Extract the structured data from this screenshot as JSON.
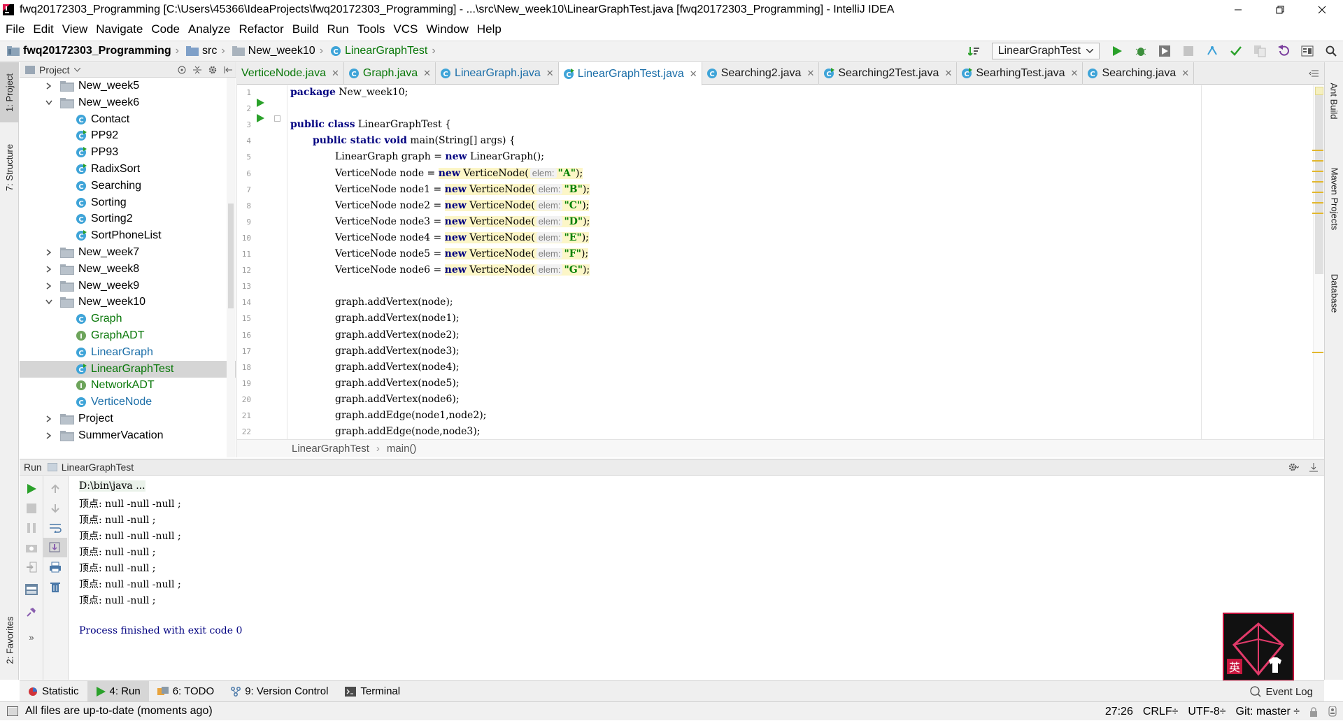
{
  "window": {
    "title": "fwq20172303_Programming [C:\\Users\\45366\\IdeaProjects\\fwq20172303_Programming] - ...\\src\\New_week10\\LinearGraphTest.java [fwq20172303_Programming] - IntelliJ IDEA"
  },
  "menu": [
    "File",
    "Edit",
    "View",
    "Navigate",
    "Code",
    "Analyze",
    "Refactor",
    "Build",
    "Run",
    "Tools",
    "VCS",
    "Window",
    "Help"
  ],
  "nav": {
    "project": "fwq20172303_Programming",
    "src": "src",
    "package": "New_week10",
    "file": "LinearGraphTest",
    "run_config": "LinearGraphTest"
  },
  "left_stripe": {
    "project": "1: Project",
    "structure": "7: Structure",
    "favorites": "2: Favorites"
  },
  "right_stripe": {
    "ant": "Ant Build",
    "maven": "Maven Projects",
    "database": "Database"
  },
  "project_panel": {
    "title": "Project",
    "rows": [
      {
        "label": "New_week5",
        "kind": "folder",
        "expanded": false
      },
      {
        "label": "New_week6",
        "kind": "folder",
        "expanded": true
      },
      {
        "label": "Contact",
        "kind": "class"
      },
      {
        "label": "PP92",
        "kind": "class-main"
      },
      {
        "label": "PP93",
        "kind": "class-main"
      },
      {
        "label": "RadixSort",
        "kind": "class-main"
      },
      {
        "label": "Searching",
        "kind": "class"
      },
      {
        "label": "Sorting",
        "kind": "class"
      },
      {
        "label": "Sorting2",
        "kind": "class"
      },
      {
        "label": "SortPhoneList",
        "kind": "class-main"
      },
      {
        "label": "New_week7",
        "kind": "folder",
        "expanded": false
      },
      {
        "label": "New_week8",
        "kind": "folder",
        "expanded": false
      },
      {
        "label": "New_week9",
        "kind": "folder",
        "expanded": false
      },
      {
        "label": "New_week10",
        "kind": "folder",
        "expanded": true
      },
      {
        "label": "Graph",
        "kind": "class",
        "vcs": "added"
      },
      {
        "label": "GraphADT",
        "kind": "interface",
        "vcs": "added"
      },
      {
        "label": "LinearGraph",
        "kind": "class",
        "vcs": "modified"
      },
      {
        "label": "LinearGraphTest",
        "kind": "class-main",
        "vcs": "added",
        "selected": true
      },
      {
        "label": "NetworkADT",
        "kind": "interface",
        "vcs": "added"
      },
      {
        "label": "VerticeNode",
        "kind": "class",
        "vcs": "modified"
      },
      {
        "label": "Project",
        "kind": "folder",
        "expanded": false
      },
      {
        "label": "SummerVacation",
        "kind": "folder",
        "expanded": false
      }
    ]
  },
  "tabs": [
    {
      "label": "VerticeNode.java",
      "vcs": "added",
      "icon": "none"
    },
    {
      "label": "Graph.java",
      "vcs": "added",
      "icon": "class"
    },
    {
      "label": "LinearGraph.java",
      "vcs": "modified",
      "icon": "class"
    },
    {
      "label": "LinearGraphTest.java",
      "vcs": "modified",
      "icon": "class-main",
      "active": true
    },
    {
      "label": "Searching2.java",
      "vcs": "normal",
      "icon": "class"
    },
    {
      "label": "Searching2Test.java",
      "vcs": "normal",
      "icon": "class-main"
    },
    {
      "label": "SearhingTest.java",
      "vcs": "normal",
      "icon": "class-main"
    },
    {
      "label": "Searching.java",
      "vcs": "normal",
      "icon": "class"
    }
  ],
  "editor": {
    "line_numbers": [
      "1",
      "2",
      "3",
      "4",
      "5",
      "6",
      "7",
      "8",
      "9",
      "10",
      "11",
      "12",
      "13",
      "14",
      "15",
      "16",
      "17",
      "18",
      "19",
      "20",
      "21",
      "22"
    ],
    "hint_label": "elem:",
    "breadcrumb": [
      "LinearGraphTest",
      "main()"
    ],
    "lines": {
      "l1": [
        "package",
        " New_week10;"
      ],
      "l3": [
        "public class",
        " LinearGraphTest {"
      ],
      "l4": [
        "public static void",
        " main(String[] args) {"
      ],
      "l5": [
        "LinearGraph graph = ",
        "new",
        " LinearGraph();"
      ],
      "nodes": [
        {
          "decl": "VerticeNode node = ",
          "val": "\"A\""
        },
        {
          "decl": "VerticeNode node1 = ",
          "val": "\"B\""
        },
        {
          "decl": "VerticeNode node2 = ",
          "val": "\"C\""
        },
        {
          "decl": "VerticeNode node3 = ",
          "val": "\"D\""
        },
        {
          "decl": "VerticeNode node4 = ",
          "val": "\"E\""
        },
        {
          "decl": "VerticeNode node5 = ",
          "val": "\"F\""
        },
        {
          "decl": "VerticeNode node6 = ",
          "val": "\"G\""
        }
      ],
      "new_kw": "new",
      "ctor": " VerticeNode(",
      "close": ");",
      "calls": [
        "graph.addVertex(node);",
        "graph.addVertex(node1);",
        "graph.addVertex(node2);",
        "graph.addVertex(node3);",
        "graph.addVertex(node4);",
        "graph.addVertex(node5);",
        "graph.addVertex(node6);",
        "graph.addEdge(node1,node2);",
        "graph.addEdge(node,node3);"
      ]
    }
  },
  "run_panel": {
    "label": "Run",
    "config": "LinearGraphTest",
    "console": [
      "D:\\bin\\java ...",
      "顶点: null -null -null ;",
      "顶点: null -null ;",
      "顶点: null -null -null ;",
      "顶点: null -null ;",
      "顶点: null -null ;",
      "顶点: null -null -null ;",
      "顶点: null -null ;",
      "",
      "Process finished with exit code 0"
    ]
  },
  "bottom_tabs": {
    "statistic": "Statistic",
    "run": "4: Run",
    "todo": "6: TODO",
    "vcs": "9: Version Control",
    "terminal": "Terminal",
    "event_log": "Event Log"
  },
  "status": {
    "message": "All files are up-to-date (moments ago)",
    "position": "27:26",
    "line_sep": "CRLF÷",
    "encoding": "UTF-8÷",
    "git": "Git: master ÷"
  },
  "colors": {
    "vcs_added": "#087708",
    "vcs_modified": "#1b6ea8",
    "keyword": "#000080",
    "string": "#008000",
    "run_green": "#2aa12a"
  }
}
